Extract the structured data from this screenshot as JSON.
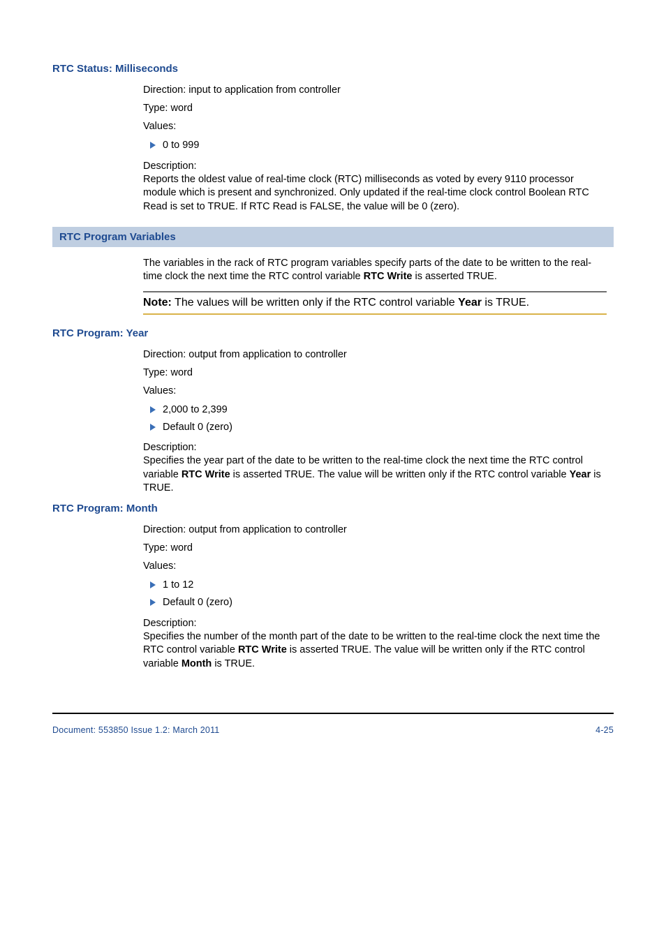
{
  "sections": {
    "rtc_status_ms": {
      "heading": "RTC Status: Milliseconds",
      "direction": "Direction: input to application from controller",
      "type": "Type: word",
      "values_label": "Values:",
      "bullet1": "0 to 999",
      "desc_label": "Description:",
      "desc_body": "Reports the oldest value of real-time clock (RTC) milliseconds as voted by every 9110 processor module which is present and synchronized. Only updated if the real-time clock control Boolean RTC Read is set to TRUE. If RTC Read is FALSE, the value will be 0 (zero)."
    },
    "rtc_program_vars": {
      "heading": "RTC Program Variables",
      "intro_pre": "The variables in the rack of RTC program variables specify parts of the date to be written to the real-time clock the next time the RTC control variable ",
      "intro_bold": "RTC Write",
      "intro_post": " is asserted TRUE.",
      "note_label": "Note:",
      "note_pre": " The values will be written only if the RTC control variable ",
      "note_bold": "Year",
      "note_post": " is TRUE."
    },
    "rtc_program_year": {
      "heading": "RTC Program: Year",
      "direction": "Direction: output from application to controller",
      "type": "Type: word",
      "values_label": "Values:",
      "bullet1": "2,000 to 2,399",
      "bullet2": "Default 0 (zero)",
      "desc_label": "Description:",
      "desc_pre": "Specifies the year part of the date to be written to the real-time clock the next time the RTC control variable ",
      "desc_b1": "RTC Write",
      "desc_mid": " is asserted TRUE. The value will be written only if the RTC control variable ",
      "desc_b2": "Year",
      "desc_post": " is TRUE."
    },
    "rtc_program_month": {
      "heading": "RTC Program: Month",
      "direction": "Direction: output from application to controller",
      "type": "Type: word",
      "values_label": "Values:",
      "bullet1": "1 to 12",
      "bullet2": "Default 0 (zero)",
      "desc_label": "Description:",
      "desc_pre": "Specifies the number of the month part of the date to be written to the real-time clock the next time the RTC control variable ",
      "desc_b1": "RTC Write",
      "desc_mid": " is asserted TRUE. The value will be written only if the RTC control variable ",
      "desc_b2": "Month",
      "desc_post": " is TRUE."
    }
  },
  "footer": {
    "left": "Document: 553850 Issue 1.2: March 2011",
    "right": "4-25"
  }
}
